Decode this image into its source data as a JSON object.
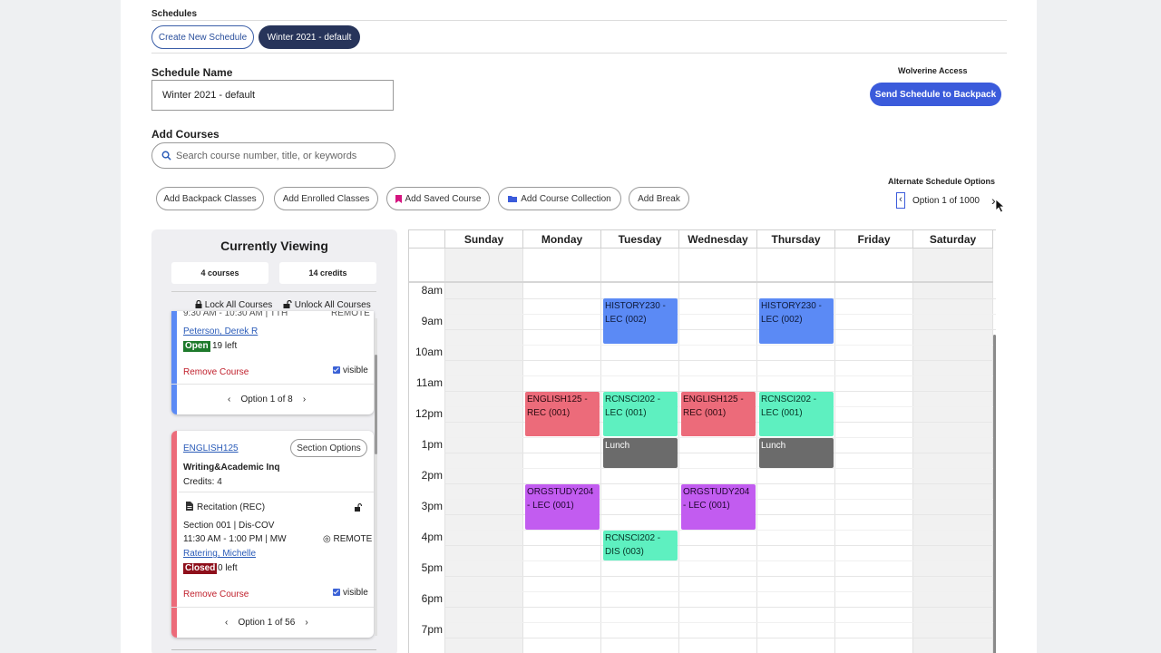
{
  "schedules": {
    "label": "Schedules",
    "create_new": "Create New Schedule",
    "current": "Winter 2021 - default"
  },
  "schedule_name": {
    "label": "Schedule Name",
    "value": "Winter 2021 - default"
  },
  "wolverine": {
    "label": "Wolverine Access",
    "button": "Send Schedule to Backpack"
  },
  "add_courses": {
    "label": "Add Courses",
    "placeholder": "Search course number, title, or keywords"
  },
  "actions": {
    "backpack": "Add Backpack Classes",
    "enrolled": "Add Enrolled Classes",
    "saved": "Add Saved Course",
    "collection": "Add Course Collection",
    "break": "Add Break"
  },
  "alternate": {
    "label": "Alternate Schedule Options",
    "option": "Option 1 of 1000"
  },
  "panel": {
    "title": "Currently Viewing",
    "courses": "4 courses",
    "credits": "14 credits",
    "lock_all": "Lock All Courses",
    "unlock_all": "Unlock All Courses",
    "card1": {
      "time_partial": "9:30 AM - 10:30 AM | TTH",
      "remote_partial": "REMOTE",
      "instructor": "Peterson, Derek R",
      "status": "Open",
      "seats": "19 left",
      "remove": "Remove Course",
      "visible": "visible",
      "option": "Option 1 of 8",
      "color": "#5b8af5"
    },
    "card2": {
      "code": "ENGLISH125",
      "section_options": "Section Options",
      "title": "Writing&Academic Inq",
      "credits": "Credits: 4",
      "type": "Recitation (REC)",
      "section": "Section 001 | Dis-COV",
      "time": "11:30 AM - 1:00 PM | MW",
      "remote": "REMOTE",
      "instructor": "Ratering, Michelle",
      "status": "Closed",
      "seats": "0 left",
      "remove": "Remove Course",
      "visible": "visible",
      "option": "Option 1 of 56",
      "color": "#ec6b7a"
    }
  },
  "calendar": {
    "days": [
      "Sunday",
      "Monday",
      "Tuesday",
      "Wednesday",
      "Thursday",
      "Friday",
      "Saturday"
    ],
    "times": [
      "8am",
      "9am",
      "10am",
      "11am",
      "12pm",
      "1pm",
      "2pm",
      "3pm",
      "4pm",
      "5pm",
      "6pm",
      "7pm"
    ],
    "events": {
      "hist_tue": "HISTORY230 - LEC (002)",
      "hist_thu": "HISTORY230 - LEC (002)",
      "eng_mon": "ENGLISH125 - REC (001)",
      "eng_wed": "ENGLISH125 - REC (001)",
      "rc_tue": "RCNSCI202 - LEC (001)",
      "rc_thu": "RCNSCI202 - LEC (001)",
      "lunch_tue": "Lunch",
      "lunch_thu": "Lunch",
      "org_mon": "ORGSTUDY204 - LEC (001)",
      "org_wed": "ORGSTUDY204 - LEC (001)",
      "rcdis_tue": "RCNSCI202 - DIS (003)"
    }
  }
}
